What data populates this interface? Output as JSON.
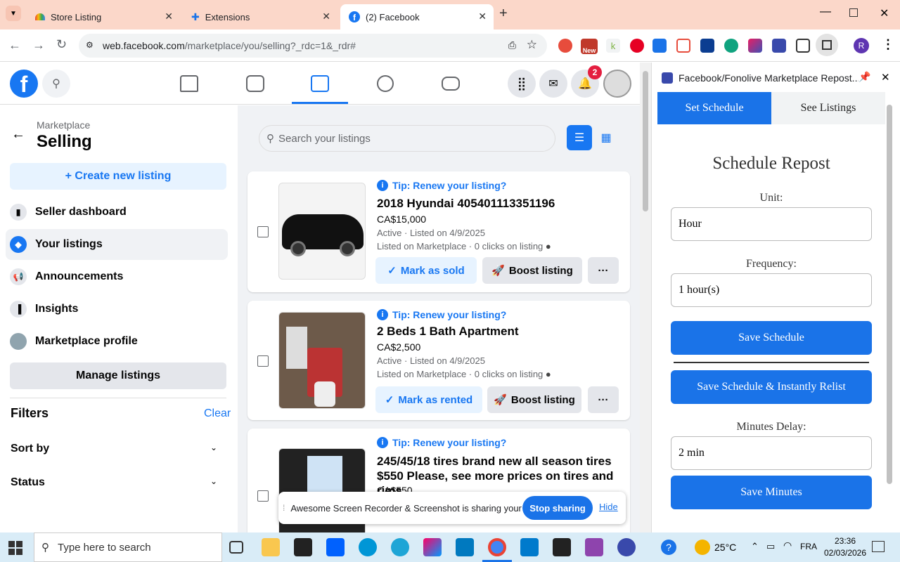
{
  "browser": {
    "tabs": [
      {
        "label": "Store Listing"
      },
      {
        "label": "Extensions"
      },
      {
        "label": "(2) Facebook"
      }
    ],
    "url_host": "web.facebook.com",
    "url_path": "/marketplace/you/selling?_rdc=1&_rdr#",
    "profile_initial": "R",
    "new_badge": "New"
  },
  "fb": {
    "notif_count": "2"
  },
  "sidebar": {
    "crumb": "Marketplace",
    "title": "Selling",
    "create_label": "+ Create new listing",
    "items": [
      {
        "label": "Seller dashboard"
      },
      {
        "label": "Your listings"
      },
      {
        "label": "Announcements"
      },
      {
        "label": "Insights"
      },
      {
        "label": "Marketplace profile"
      }
    ],
    "manage_label": "Manage listings",
    "filters_label": "Filters",
    "clear_label": "Clear",
    "sort_label": "Sort by",
    "status_label": "Status"
  },
  "main": {
    "search_placeholder": "Search your listings",
    "listings": [
      {
        "tip": "Tip: Renew your listing?",
        "title": "2018 Hyundai 405401113351196",
        "price": "CA$15,000",
        "status": "Active · Listed on 4/9/2025",
        "info": "Listed on Marketplace · 0 clicks on listing",
        "action": "Mark as sold",
        "boost": "Boost listing"
      },
      {
        "tip": "Tip: Renew your listing?",
        "title": "2 Beds 1 Bath Apartment",
        "price": "CA$2,500",
        "status": "Active · Listed on 4/9/2025",
        "info": "Listed on Marketplace · 0 clicks on listing",
        "action": "Mark as rented",
        "boost": "Boost listing"
      },
      {
        "tip": "Tip: Renew your listing?",
        "title": "245/45/18 tires brand new all season tires $550 Please, see more prices on tires and rims,...",
        "price": "CA$550"
      }
    ],
    "share_bar": {
      "text": "Awesome Screen Recorder & Screenshot is sharing your screen.",
      "stop": "Stop sharing",
      "hide": "Hide"
    }
  },
  "extension": {
    "title": "Facebook/Fonolive Marketplace Repost...",
    "tabs": [
      {
        "label": "Set Schedule"
      },
      {
        "label": "See Listings"
      }
    ],
    "heading": "Schedule Repost",
    "unit_label": "Unit:",
    "unit_value": "Hour",
    "freq_label": "Frequency:",
    "freq_value": "1 hour(s)",
    "save_schedule": "Save Schedule",
    "save_relist": "Save Schedule & Instantly Relist",
    "delay_label": "Minutes Delay:",
    "delay_value": "2 min",
    "save_minutes": "Save Minutes"
  },
  "taskbar": {
    "search_placeholder": "Type here to search",
    "temp": "25°C",
    "lang": "FRA",
    "time": "23:36",
    "date": "02/03/2026"
  },
  "colors": {
    "fb_blue": "#1877f2",
    "ext_blue": "#1a73e8",
    "tab_bg": "#fbd7c9"
  }
}
